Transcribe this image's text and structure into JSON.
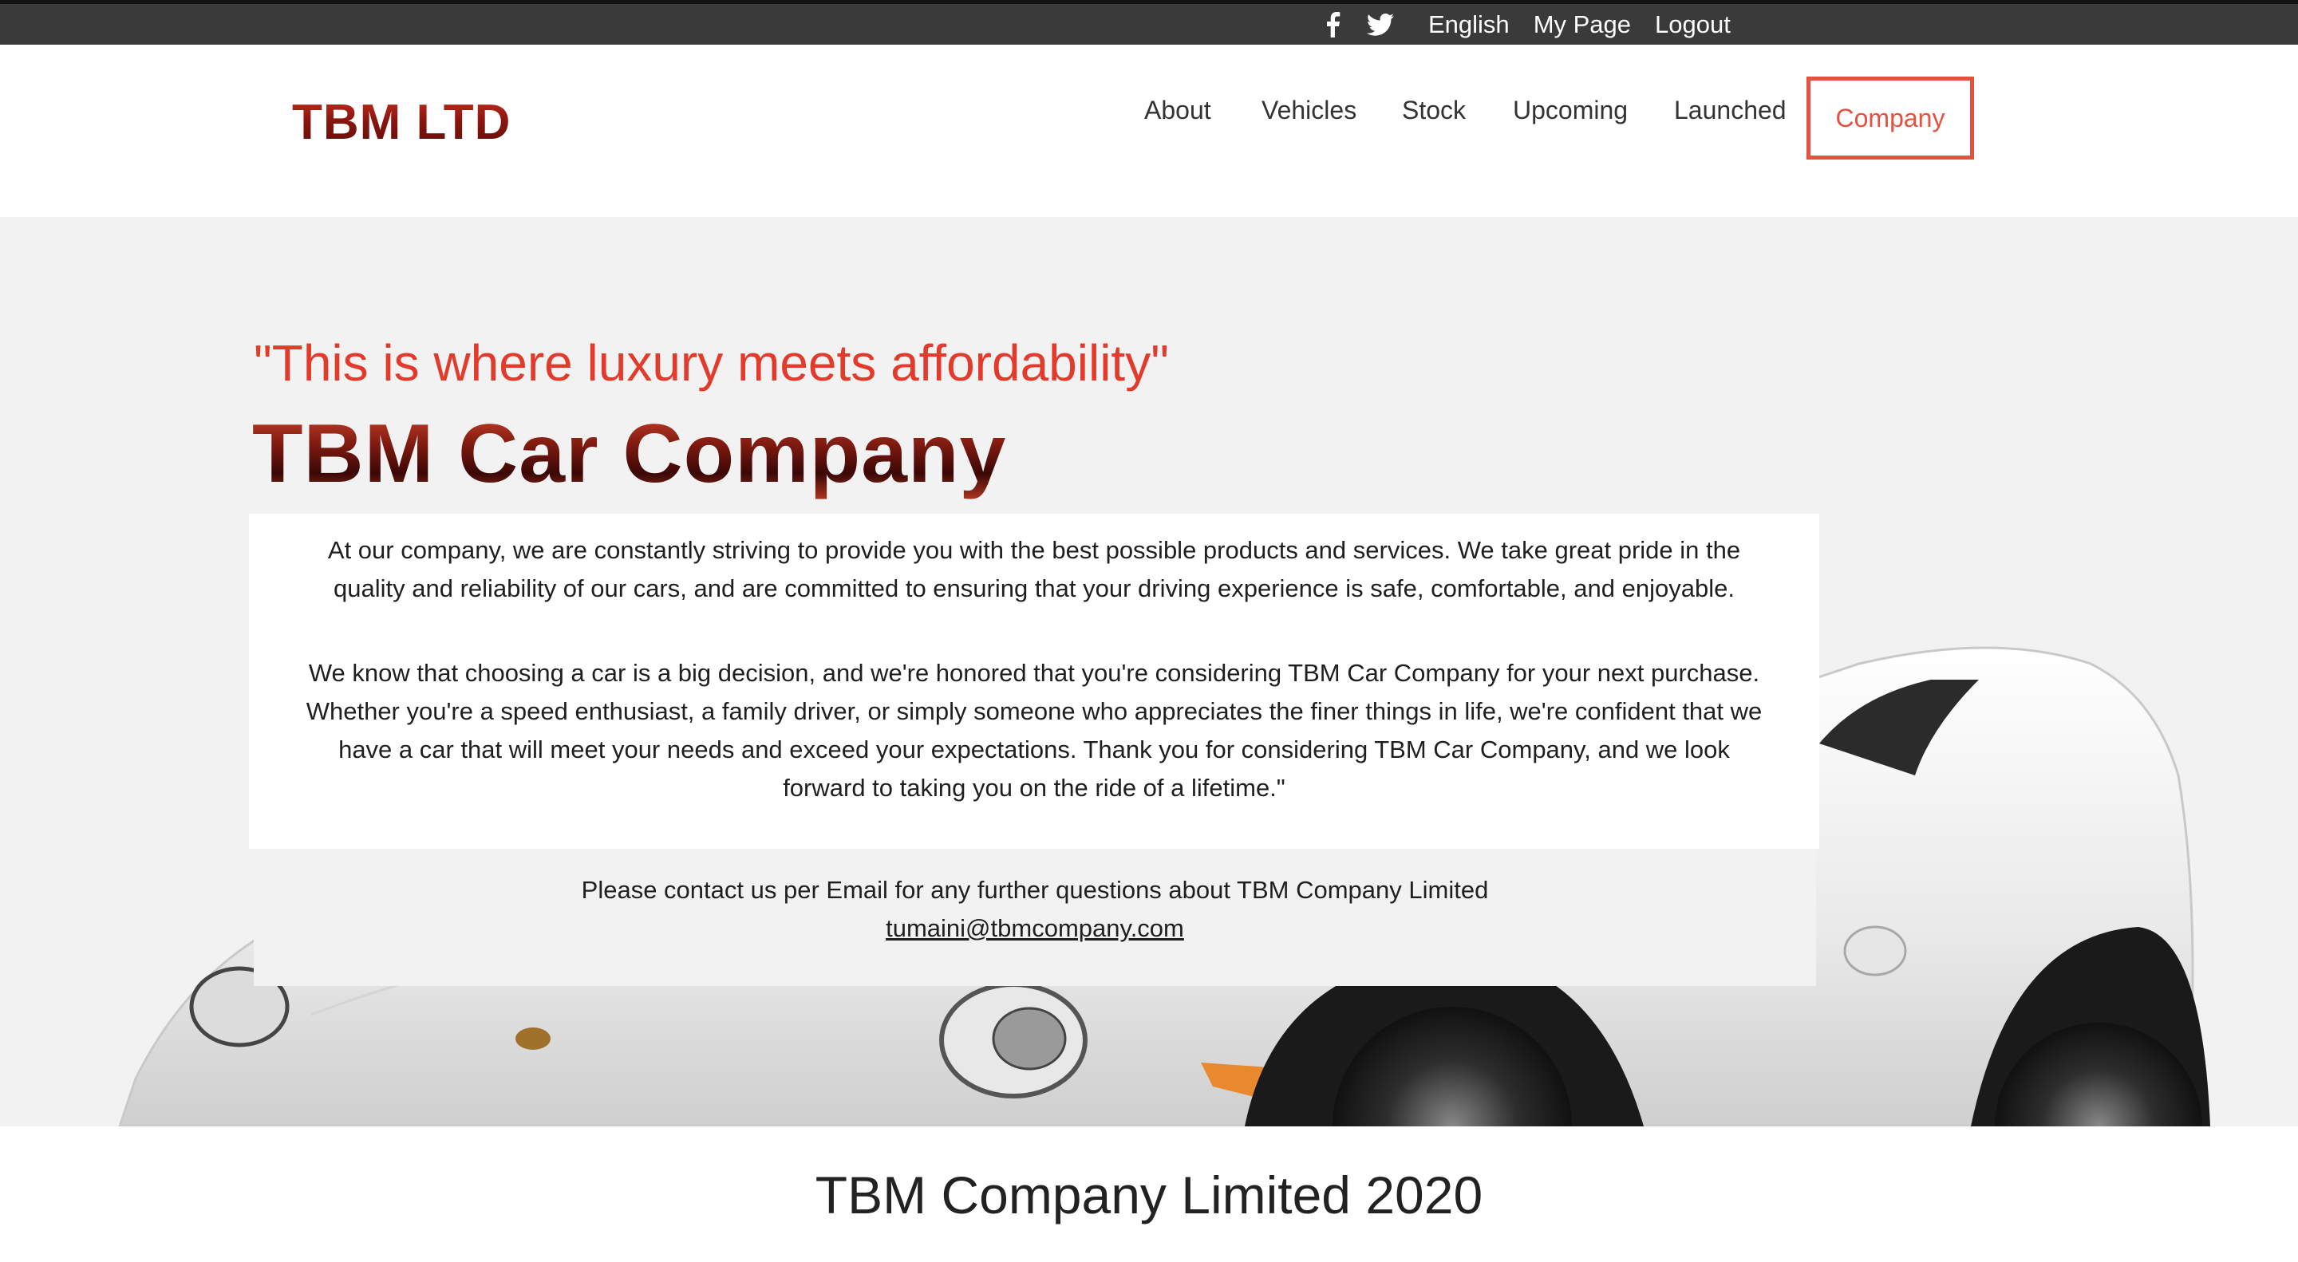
{
  "topbar": {
    "social": [
      {
        "icon": "facebook-icon"
      },
      {
        "icon": "twitter-icon"
      }
    ],
    "language": "English",
    "my_page": "My Page",
    "logout": "Logout"
  },
  "header": {
    "logo": "TBM LTD",
    "nav": {
      "about": "About",
      "vehicles": "Vehicles",
      "stock": "Stock",
      "upcoming": "Upcoming",
      "launched": "Launched",
      "company": "Company"
    },
    "active_item": "Company",
    "accent_color": "#e5513f"
  },
  "hero": {
    "tagline": "\"This is where luxury meets affordability\"",
    "title": "TBM Car Company",
    "paragraph1": "At our company, we are constantly striving to provide you with the best possible products and services. We take great pride in the quality and reliability of our cars, and are committed to ensuring that your driving experience is safe, comfortable, and enjoyable.",
    "paragraph2": "We know that choosing a car is a big decision, and we're honored that you're considering TBM Car Company for your next purchase. Whether you're a speed enthusiast, a family driver, or simply someone who appreciates the finer things in life, we're confident that we have a car that will meet your needs and exceed your expectations. Thank you for considering TBM Car Company, and we look forward to taking you on the ride of a lifetime.\"",
    "contact_text": "Please contact us per Email for any further questions about TBM Company Limited",
    "contact_email": "tumaini@tbmcompany.com",
    "background_image": "white-sports-car"
  },
  "footer": {
    "title": "TBM Company Limited 2020"
  }
}
